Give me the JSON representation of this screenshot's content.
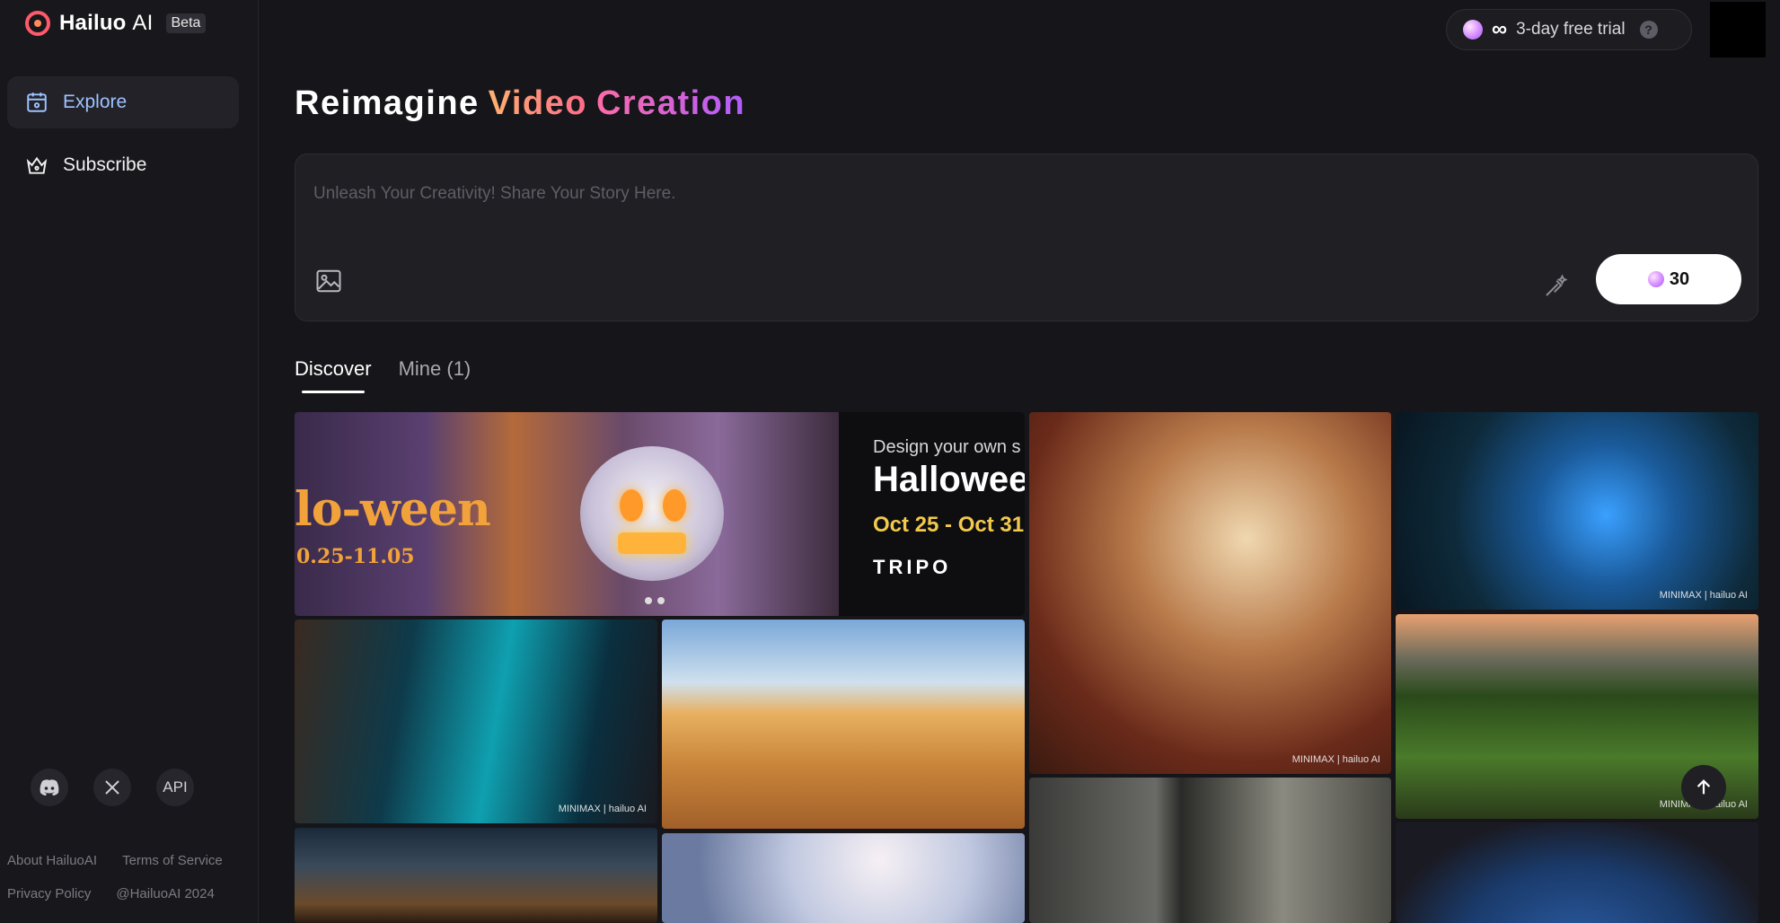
{
  "app": {
    "name": "Hailuo",
    "name_suffix": "AI",
    "beta": "Beta"
  },
  "sidebar": {
    "items": [
      {
        "label": "Explore",
        "icon": "explore-icon",
        "active": true
      },
      {
        "label": "Subscribe",
        "icon": "crown-icon",
        "active": false
      }
    ],
    "social": {
      "discord_icon": "discord-icon",
      "x_icon": "x-logo-icon",
      "api_label": "API"
    },
    "footer": {
      "about": "About HailuoAI",
      "terms": "Terms of Service",
      "privacy": "Privacy Policy",
      "copyright": "@HailuoAI 2024"
    }
  },
  "topbar": {
    "trial_label": "3-day free trial",
    "infinity": "∞",
    "help": "?"
  },
  "hero": {
    "word1": "Reimagine",
    "word2": "Video",
    "word3": "Creation"
  },
  "prompt": {
    "placeholder": "Unleash Your Creativity! Share Your Story Here.",
    "value": "",
    "credits": "30"
  },
  "tabs": [
    {
      "label": "Discover",
      "active": true
    },
    {
      "label": "Mine (1)",
      "active": false
    }
  ],
  "banner": {
    "title": "lo-ween",
    "date": "0.25-11.05",
    "line1": "Design your own s",
    "line2": "Hallowee",
    "line3": "Oct 25 - Oct 31",
    "line4": "TRIPO"
  },
  "watermarks": {
    "default": "MINIMAX | hailuo AI"
  },
  "colors": {
    "accent_blue": "#9ec3ff",
    "gradient_orange": "#ffb170",
    "gradient_pink": "#ff6a8a",
    "gradient_purple": "#b05cff"
  }
}
